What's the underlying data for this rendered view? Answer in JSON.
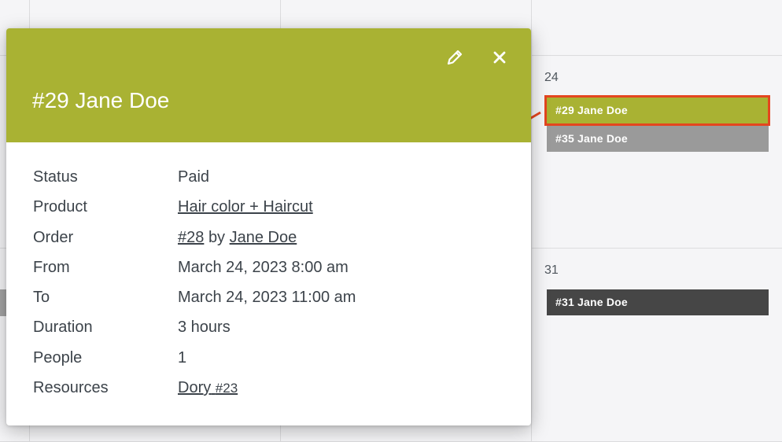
{
  "calendar": {
    "days": [
      {
        "number": "24"
      },
      {
        "number": "31"
      }
    ],
    "events": [
      {
        "label": "#29 Jane Doe"
      },
      {
        "label": "#35 Jane Doe"
      },
      {
        "label": "#31 Jane Doe"
      }
    ],
    "colors": {
      "green": "#a9b233",
      "gray": "#9a9a9a",
      "dark": "#464646",
      "highlight": "#e4461f"
    }
  },
  "popup": {
    "title": "#29 Jane Doe",
    "header_color": "#a9b233",
    "actions": {
      "edit_icon": "pencil-icon",
      "close_icon": "close-icon"
    },
    "fields": {
      "status": {
        "label": "Status",
        "value": "Paid"
      },
      "product": {
        "label": "Product",
        "value": "Hair color + Haircut"
      },
      "order": {
        "label": "Order",
        "number": "#28",
        "by": "by",
        "customer": "Jane Doe"
      },
      "from": {
        "label": "From",
        "value": "March 24, 2023 8:00 am"
      },
      "to": {
        "label": "To",
        "value": "March 24, 2023 11:00 am"
      },
      "duration": {
        "label": "Duration",
        "value": "3 hours"
      },
      "people": {
        "label": "People",
        "value": "1"
      },
      "resources": {
        "label": "Resources",
        "name": "Dory",
        "id": "#23"
      }
    }
  }
}
